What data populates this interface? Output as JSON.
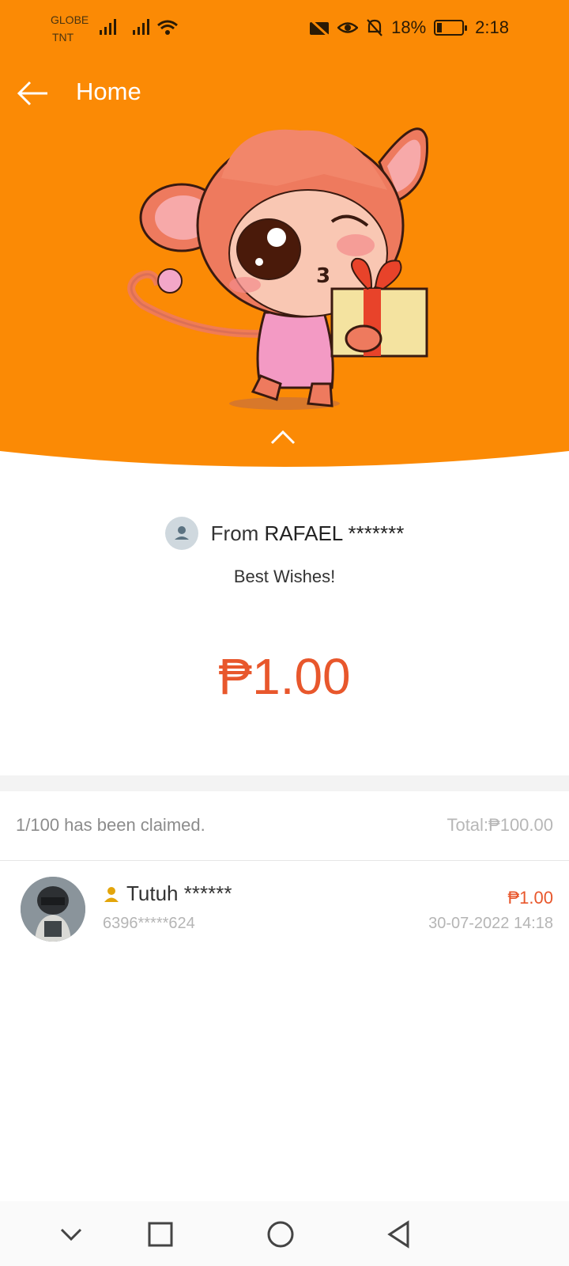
{
  "status_bar": {
    "carrier_1": "GLOBE",
    "carrier_2": "TNT",
    "battery": "18%",
    "time": "2:18"
  },
  "header": {
    "title": "Home",
    "bg_color": "#fb8a05"
  },
  "gift": {
    "from_prefix": "From ",
    "from_name": "RAFAEL *******",
    "message": "Best Wishes!",
    "amount": "₱1.00",
    "accent_color": "#e8572c"
  },
  "claims": {
    "summary": "1/100 has been claimed.",
    "total": "Total:₱100.00",
    "list": [
      {
        "name": "Tutuh ******",
        "phone": "6396*****624",
        "amount": "₱1.00",
        "time": "30-07-2022 14:18"
      }
    ]
  },
  "icons": {
    "back": "arrow-left-icon",
    "collapse": "chevron-up-icon",
    "user": "user-icon",
    "nav": [
      "chevron-down-icon",
      "square-icon",
      "circle-icon",
      "triangle-back-icon"
    ]
  }
}
